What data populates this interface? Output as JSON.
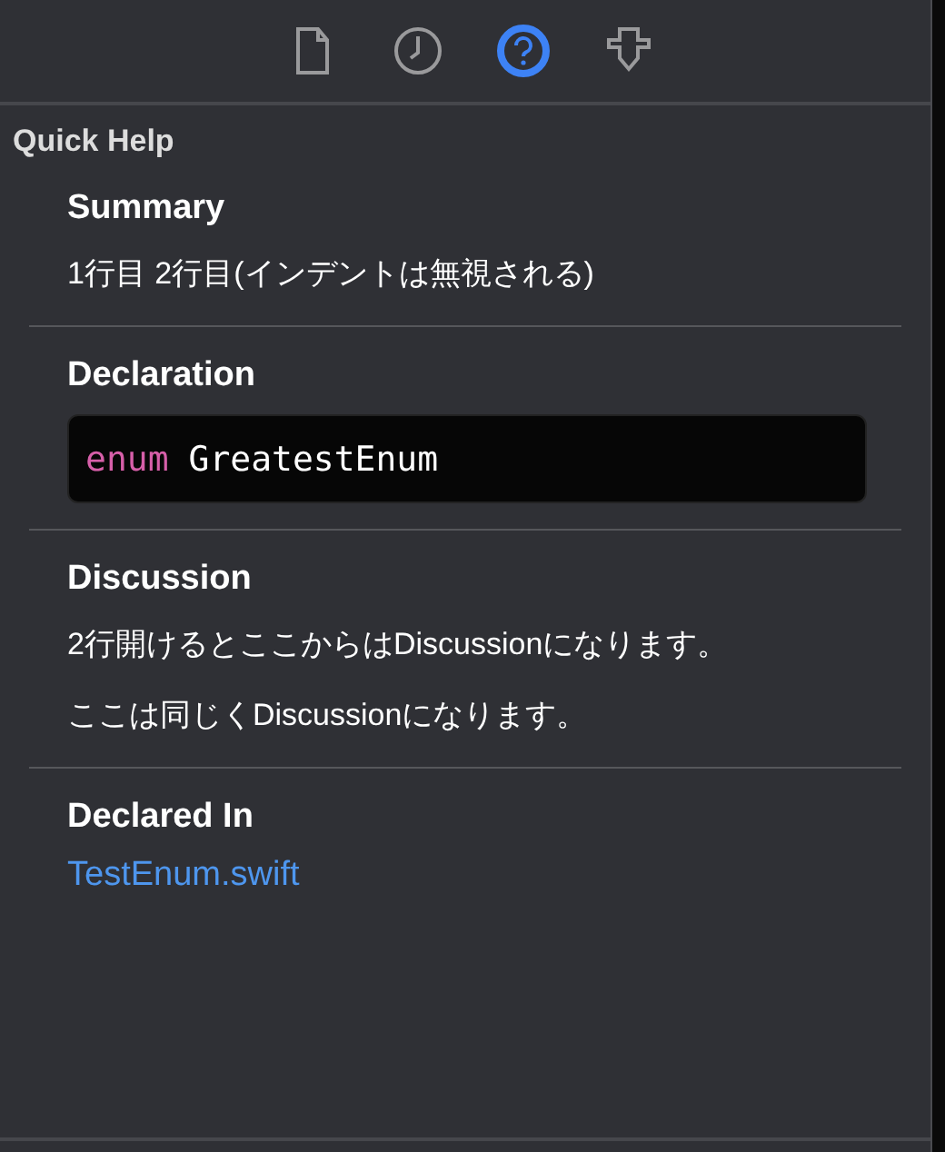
{
  "toolbar": {
    "tabs": [
      {
        "kind": "file",
        "selected": false
      },
      {
        "kind": "history",
        "selected": false
      },
      {
        "kind": "help",
        "selected": true
      },
      {
        "kind": "pin",
        "selected": false
      }
    ]
  },
  "panel_title": "Quick Help",
  "sections": [
    {
      "kind": "text",
      "title": "Summary",
      "paragraphs": [
        "1行目 2行目(インデントは無視される)"
      ]
    },
    {
      "kind": "code",
      "title": "Declaration",
      "tokens": [
        {
          "kind": "keyword",
          "text": "enum"
        },
        {
          "kind": "plain",
          "text": "GreatestEnum"
        }
      ]
    },
    {
      "kind": "text",
      "title": "Discussion",
      "paragraphs": [
        "2行開けるとここからはDiscussionになります。",
        "ここは同じくDiscussionになります。"
      ]
    },
    {
      "kind": "link",
      "title": "Declared In",
      "link": "TestEnum.swift"
    }
  ]
}
